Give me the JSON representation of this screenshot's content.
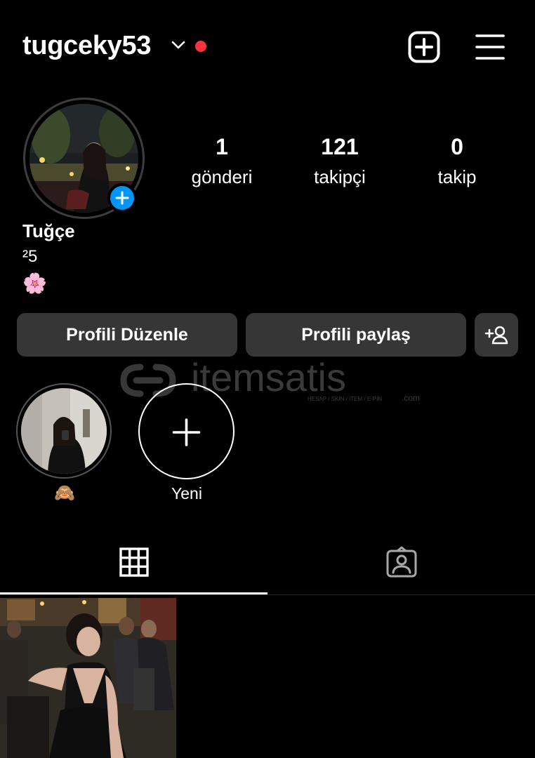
{
  "profile": {
    "username": "tugceky53",
    "name": "Tuğçe",
    "bio_line1": "²5",
    "bio_line2": "🌸"
  },
  "stats": [
    {
      "value": "1",
      "label": "gönderi"
    },
    {
      "value": "121",
      "label": "takipçi"
    },
    {
      "value": "0",
      "label": "takip"
    }
  ],
  "buttons": {
    "edit": "Profili Düzenle",
    "share": "Profili paylaş"
  },
  "highlights": [
    {
      "label": "🙈"
    },
    {
      "label": "Yeni"
    }
  ],
  "watermark": {
    "text": "itemsatis",
    "sub": "HESAP / SKIN / ITEM / E-PIN",
    "suffix": ".com"
  },
  "colors": {
    "background": "#000000",
    "button": "#363636",
    "accent_blue": "#0095f6",
    "notification_dot": "#ff3040"
  },
  "icons": [
    "chevron-down-icon",
    "new-post-icon",
    "menu-icon",
    "add-story-icon",
    "add-person-icon",
    "plus-icon",
    "grid-icon",
    "tagged-icon"
  ]
}
